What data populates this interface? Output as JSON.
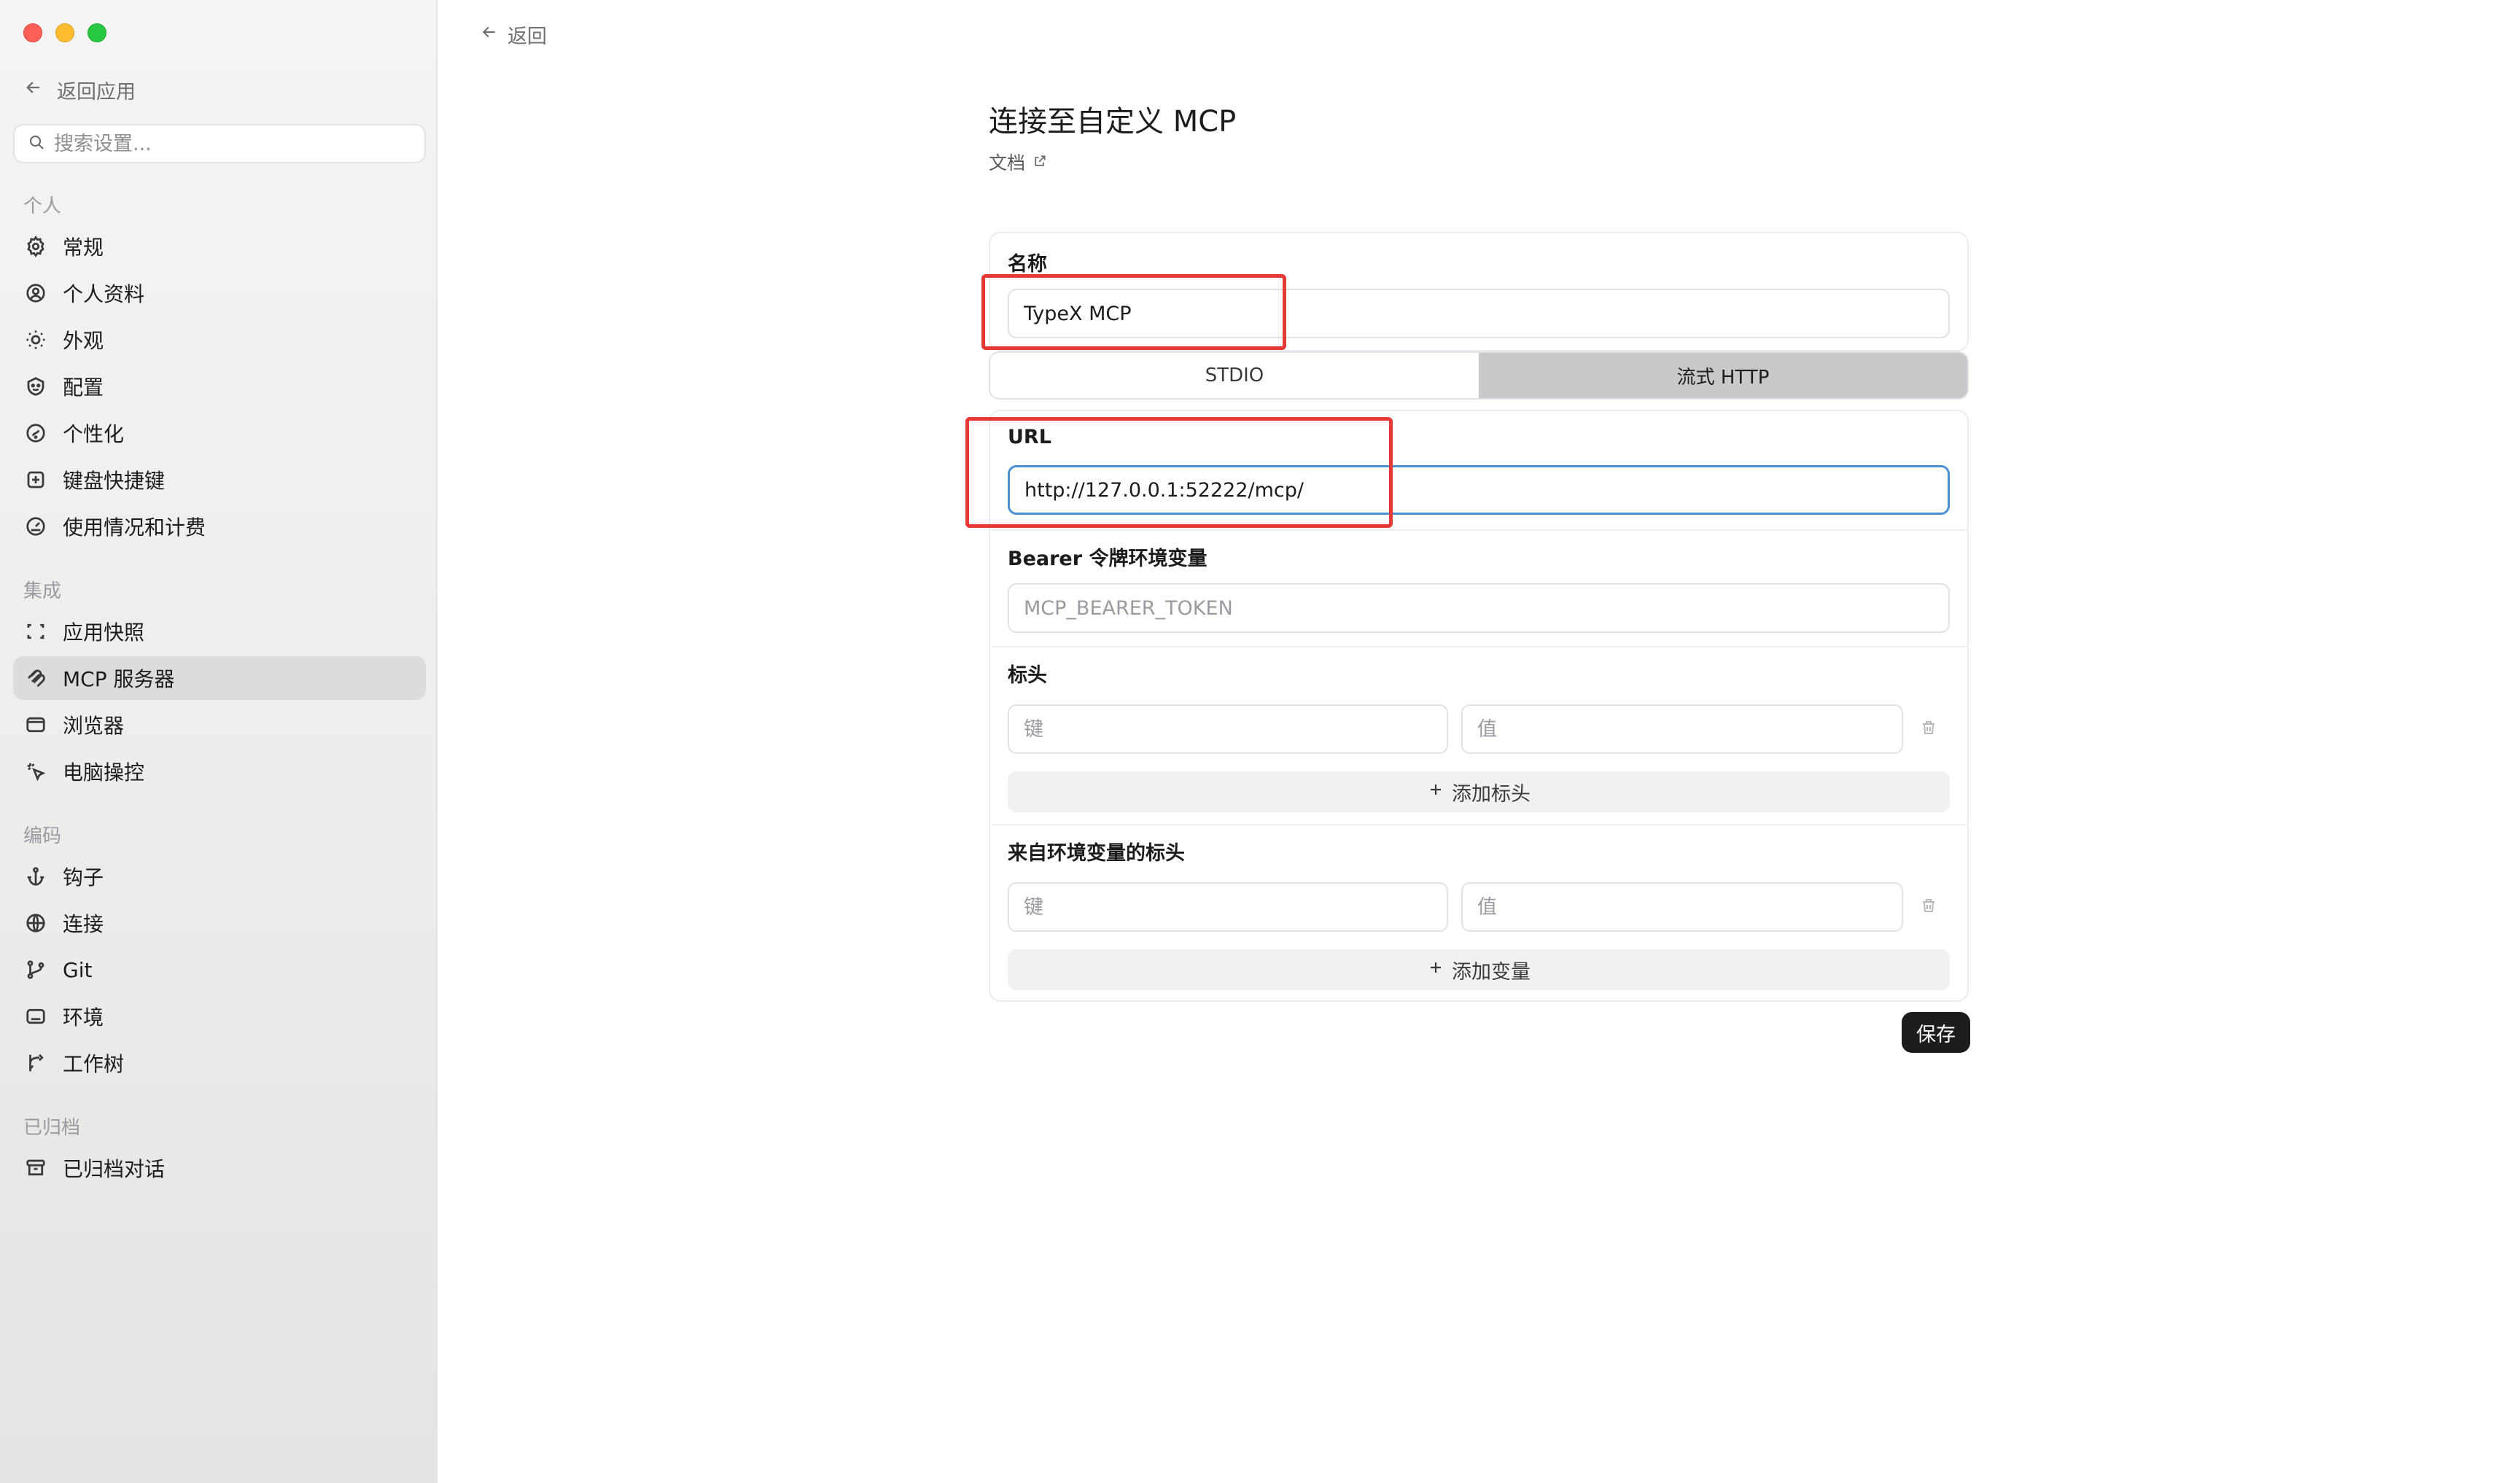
{
  "sidebar": {
    "back_label": "返回应用",
    "search_placeholder": "搜索设置...",
    "sections": {
      "personal": "个人",
      "integration": "集成",
      "coding": "编码",
      "archived": "已归档"
    },
    "items": [
      {
        "label": "常规",
        "icon": "gear-icon"
      },
      {
        "label": "个人资料",
        "icon": "user-circle-icon"
      },
      {
        "label": "外观",
        "icon": "sun-icon"
      },
      {
        "label": "配置",
        "icon": "config-icon"
      },
      {
        "label": "个性化",
        "icon": "personalize-icon"
      },
      {
        "label": "键盘快捷键",
        "icon": "keyboard-icon"
      },
      {
        "label": "使用情况和计费",
        "icon": "gauge-icon"
      },
      {
        "label": "应用快照",
        "icon": "snapshot-icon"
      },
      {
        "label": "MCP 服务器",
        "icon": "mcp-icon",
        "active": true
      },
      {
        "label": "浏览器",
        "icon": "browser-icon"
      },
      {
        "label": "电脑操控",
        "icon": "cursor-icon"
      },
      {
        "label": "钩子",
        "icon": "anchor-icon"
      },
      {
        "label": "连接",
        "icon": "globe-icon"
      },
      {
        "label": "Git",
        "icon": "git-branch-icon"
      },
      {
        "label": "环境",
        "icon": "terminal-icon"
      },
      {
        "label": "工作树",
        "icon": "worktree-icon"
      },
      {
        "label": "已归档对话",
        "icon": "archive-icon"
      }
    ]
  },
  "main": {
    "back_label": "返回",
    "title": "连接至自定义 MCP",
    "docs_label": "文档",
    "name_label": "名称",
    "name_value": "TypeX MCP",
    "transport": {
      "options": [
        "STDIO",
        "流式 HTTP"
      ],
      "selected": "流式 HTTP"
    },
    "url_label": "URL",
    "url_value": "http://127.0.0.1:52222/mcp/",
    "bearer_label": "Bearer 令牌环境变量",
    "bearer_placeholder": "MCP_BEARER_TOKEN",
    "headers_label": "标头",
    "key_placeholder": "键",
    "value_placeholder": "值",
    "add_header_label": "添加标头",
    "env_headers_label": "来自环境变量的标头",
    "add_variable_label": "添加变量",
    "save_label": "保存"
  },
  "colors": {
    "accent_focus": "#4b8fd6",
    "highlight": "#e53935",
    "save_button": "#1c1c1e"
  }
}
